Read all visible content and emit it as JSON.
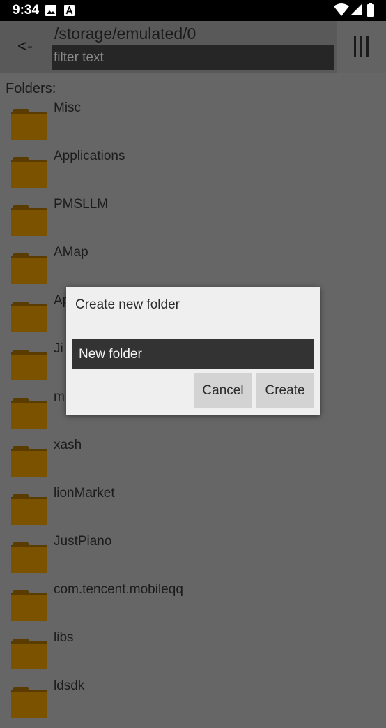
{
  "status_bar": {
    "time": "9:34"
  },
  "toolbar": {
    "back_label": "<-",
    "path": "/storage/emulated/0",
    "filter_placeholder": "filter text"
  },
  "folders_label": "Folders:",
  "folders": [
    "Misc",
    "Applications",
    "PMSLLM",
    "AMap",
    "Ap",
    "Ji",
    "m",
    "xash",
    "lionMarket",
    "JustPiano",
    "com.tencent.mobileqq",
    "libs",
    "ldsdk"
  ],
  "dialog": {
    "title": "Create new folder",
    "input_value": "New folder",
    "cancel_label": "Cancel",
    "create_label": "Create"
  },
  "colors": {
    "folder_body": "#7a5200",
    "folder_tab": "#5a3c00",
    "background": "#666666"
  }
}
